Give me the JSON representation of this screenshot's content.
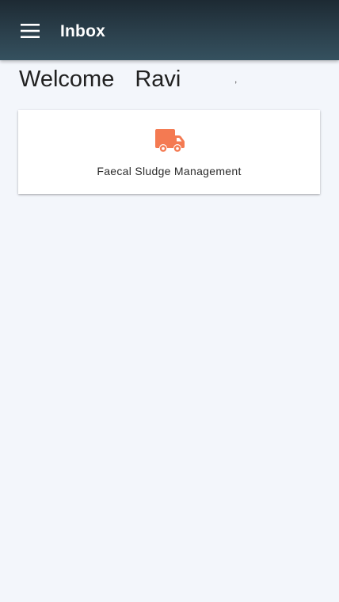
{
  "header": {
    "title": "Inbox",
    "menu_icon": "hamburger-menu-icon"
  },
  "welcome": {
    "greeting": "Welcome",
    "user_name": "Ravi",
    "tail": ","
  },
  "modules": [
    {
      "label": "Faecal Sludge Management",
      "icon": "truck-icon",
      "icon_color": "#f47a52"
    }
  ],
  "colors": {
    "header_bg": "#2b404c",
    "page_bg": "#f3f6fb",
    "accent": "#f47a52"
  }
}
